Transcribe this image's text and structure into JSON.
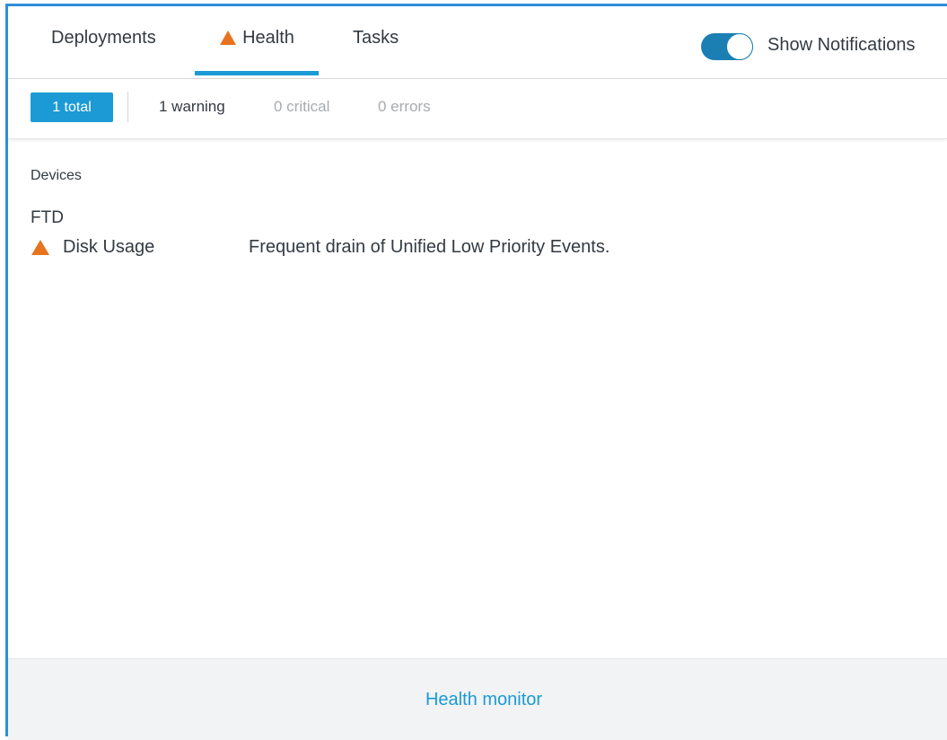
{
  "tabs": [
    {
      "label": "Deployments"
    },
    {
      "label": "Health",
      "icon": "warning-icon",
      "active": true
    },
    {
      "label": "Tasks"
    }
  ],
  "notifications_toggle": {
    "label": "Show Notifications",
    "on": true
  },
  "filters": {
    "total": "1 total",
    "warning": "1 warning",
    "critical": "0 critical",
    "errors": "0 errors"
  },
  "content": {
    "section_label": "Devices",
    "device": "FTD",
    "alerts": [
      {
        "icon": "warning-icon",
        "name": "Disk Usage",
        "description": "Frequent drain of Unified Low Priority Events."
      }
    ]
  },
  "footer": {
    "link_label": "Health monitor"
  },
  "colors": {
    "accent": "#1b9ad6",
    "warning": "#e8731e",
    "toggle": "#1b7fb4"
  }
}
